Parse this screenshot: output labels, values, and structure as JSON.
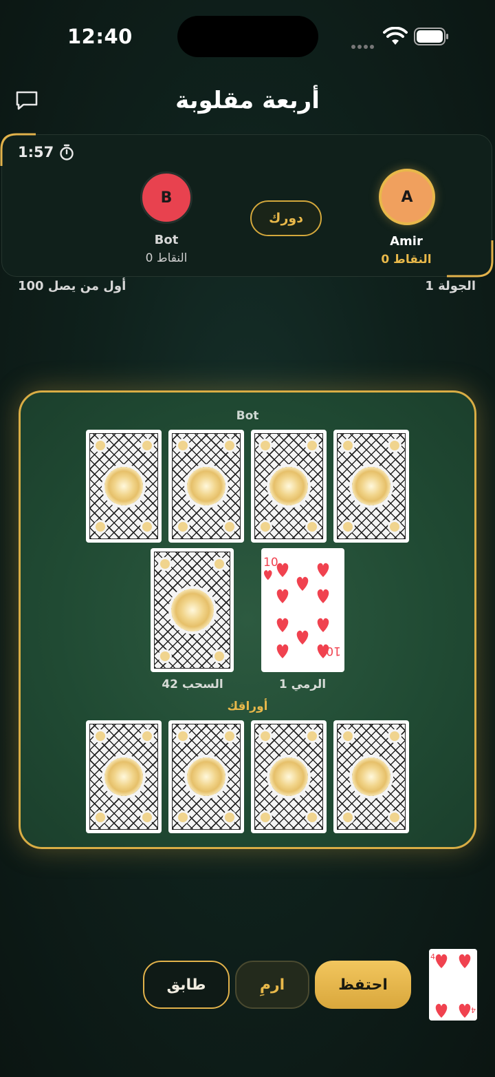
{
  "status_bar": {
    "time": "12:40"
  },
  "header": {
    "title": "أربعة مقلوبة"
  },
  "players_panel": {
    "timer": "1:57",
    "opponent": {
      "initial": "B",
      "name": "Bot",
      "points": "النقاط 0",
      "avatar_color": "#e8424f"
    },
    "you": {
      "initial": "A",
      "name": "Amir",
      "points": "النقاط 0",
      "avatar_color": "#f0a05e"
    },
    "turn_badge": "دورك",
    "round": "الجولة 1",
    "goal": "أول من يصل 100"
  },
  "table": {
    "opponent_label": "Bot",
    "your_cards_label": "أوراقك",
    "draw_pile_label": "42 السحب",
    "discard_pile_label": "1 الرمي",
    "discard_top_card": {
      "rank": "10",
      "suit": "hearts"
    },
    "opponent_hand_count": 4,
    "your_hand_count": 4
  },
  "drawn_card": {
    "rank": "4",
    "suit": "hearts"
  },
  "actions": {
    "match": "طابق",
    "throw": "ارمِ",
    "keep": "احتفظ"
  },
  "colors": {
    "accent_gold": "#e8b84a",
    "felt_green": "#204a33",
    "background": "#0c1814"
  }
}
